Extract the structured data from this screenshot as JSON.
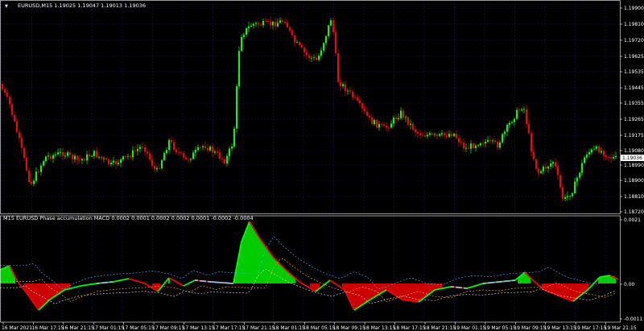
{
  "main_chart": {
    "title": "EURUSD,M15  1.19025 1.19047 1.19013 1.19036",
    "dropdown_glyph": "▼",
    "price_labels": [
      "1.19900",
      "1.19810",
      "1.19720",
      "1.19625",
      "1.19535",
      "1.19445",
      "1.19355",
      "1.19265",
      "1.19175",
      "1.19080",
      "1.18990",
      "1.18900",
      "1.18810",
      "1.18720"
    ],
    "current_price": "1.19036",
    "bull_color": "#00ff00",
    "bear_color": "#ff0000",
    "grid_color": "#14145a"
  },
  "indicator": {
    "title": "M15 EURUSD Phase accumulation MACD 0.0002 0.0001 0.0002 0.0002 0.0001 -0.0002 -0.0004",
    "scale_labels": [
      "0.0021",
      "0.00",
      "-0.0011"
    ],
    "positive_color": "#00ff00",
    "negative_color": "#ff0000",
    "line_color": "#a8c0e0"
  },
  "time_axis": [
    "16 Mar 2021",
    "16 Mar 17:15",
    "16 Mar 21:15",
    "17 Mar 01:15",
    "17 Mar 05:15",
    "17 Mar 09:15",
    "17 Mar 13:15",
    "17 Mar 17:15",
    "17 Mar 21:15",
    "18 Mar 01:15",
    "18 Mar 05:15",
    "18 Mar 09:15",
    "18 Mar 13:15",
    "18 Mar 17:15",
    "18 Mar 21:15",
    "19 Mar 01:15",
    "19 Mar 05:15",
    "19 Mar 09:15",
    "19 Mar 13:15",
    "19 Mar 17:15",
    "19 Mar 21:15"
  ]
}
